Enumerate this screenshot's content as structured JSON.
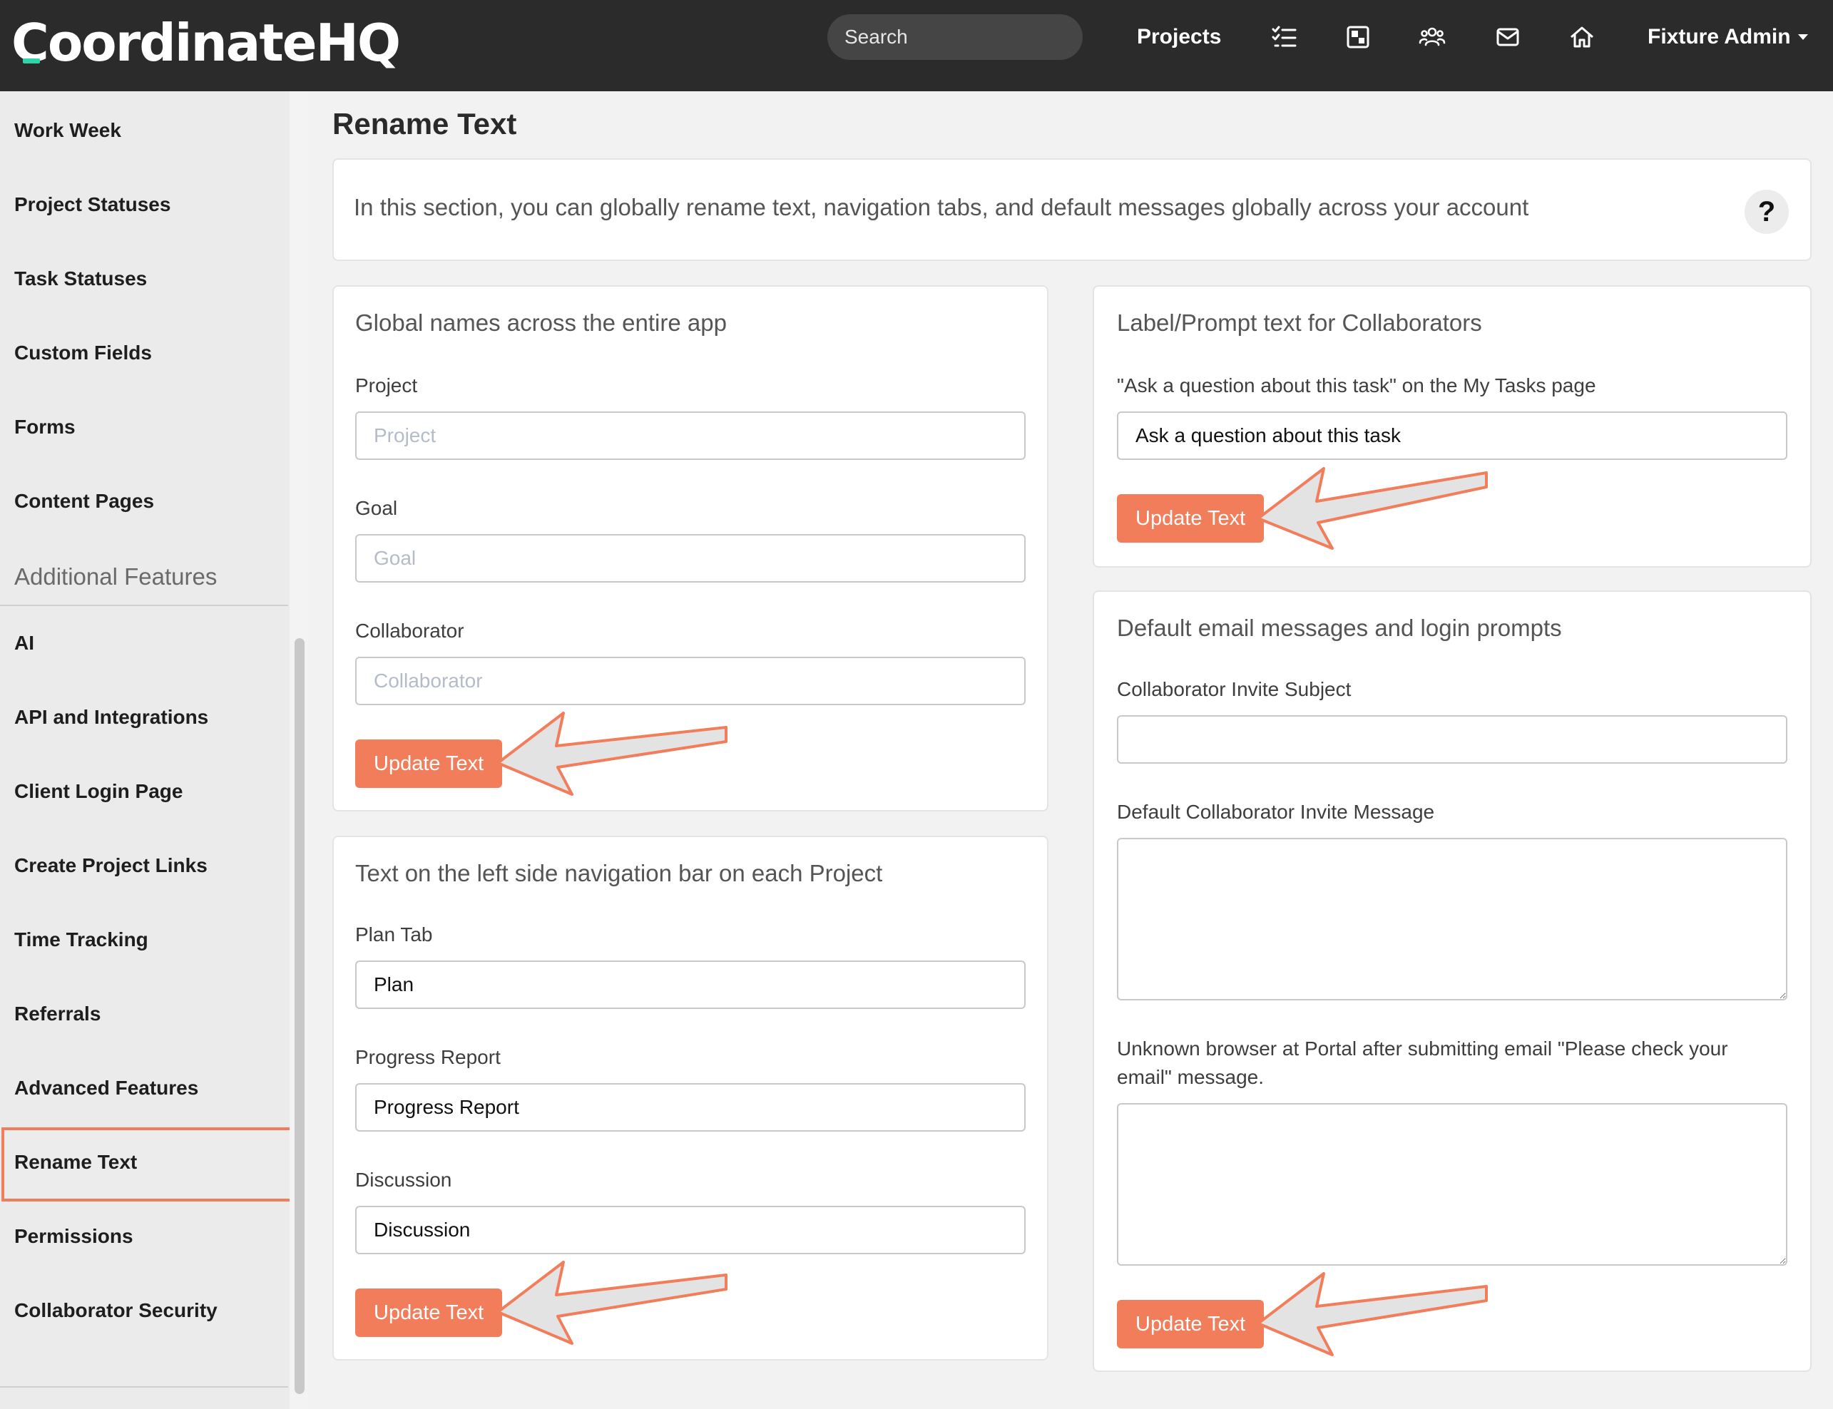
{
  "header": {
    "logo": "CoordinateHQ",
    "search_placeholder": "Search",
    "projects_label": "Projects",
    "user_label": "Fixture Admin",
    "icons": [
      "task-list-icon",
      "dashboard-icon",
      "users-icon",
      "mail-icon",
      "home-icon",
      "caret-down-icon"
    ]
  },
  "sidebar": {
    "items": [
      {
        "label": "Work Week"
      },
      {
        "label": "Project Statuses"
      },
      {
        "label": "Task Statuses"
      },
      {
        "label": "Custom Fields"
      },
      {
        "label": "Forms"
      },
      {
        "label": "Content Pages"
      }
    ],
    "section_heading": "Additional Features",
    "features": [
      {
        "label": "AI"
      },
      {
        "label": "API and Integrations"
      },
      {
        "label": "Client Login Page"
      },
      {
        "label": "Create Project Links"
      },
      {
        "label": "Time Tracking"
      },
      {
        "label": "Referrals"
      },
      {
        "label": "Advanced Features"
      },
      {
        "label": "Rename Text",
        "active": true
      },
      {
        "label": "Permissions"
      },
      {
        "label": "Collaborator Security"
      }
    ]
  },
  "main": {
    "title": "Rename Text",
    "intro": "In this section, you can globally rename text, navigation tabs, and default messages globally across your account",
    "help": "?",
    "global_names": {
      "title": "Global names across the entire app",
      "fields": [
        {
          "label": "Project",
          "value": "",
          "placeholder": "Project"
        },
        {
          "label": "Goal",
          "value": "",
          "placeholder": "Goal"
        },
        {
          "label": "Collaborator",
          "value": "",
          "placeholder": "Collaborator"
        }
      ],
      "button": "Update Text"
    },
    "left_nav": {
      "title": "Text on the left side navigation bar on each Project",
      "fields": [
        {
          "label": "Plan Tab",
          "value": "Plan"
        },
        {
          "label": "Progress Report",
          "value": "Progress Report"
        },
        {
          "label": "Discussion",
          "value": "Discussion"
        }
      ],
      "button": "Update Text"
    },
    "collaborator_prompts": {
      "title": "Label/Prompt text for Collaborators",
      "field_label": "\"Ask a question about this task\" on the My Tasks page",
      "field_value": "Ask a question about this task",
      "button": "Update Text"
    },
    "email_messages": {
      "title": "Default email messages and login prompts",
      "subject_label": "Collaborator Invite Subject",
      "subject_value": "",
      "message_label": "Default Collaborator Invite Message",
      "message_value": "",
      "browser_label": "Unknown browser at Portal after submitting email \"Please check your email\" message.",
      "browser_value": "",
      "button": "Update Text"
    }
  },
  "colors": {
    "header_bg": "#2b2b2b",
    "accent": "#f17d5b",
    "logo_accent": "#2ed5a8",
    "sidebar_bg": "#ebebeb",
    "page_bg": "#f2f2f2"
  }
}
